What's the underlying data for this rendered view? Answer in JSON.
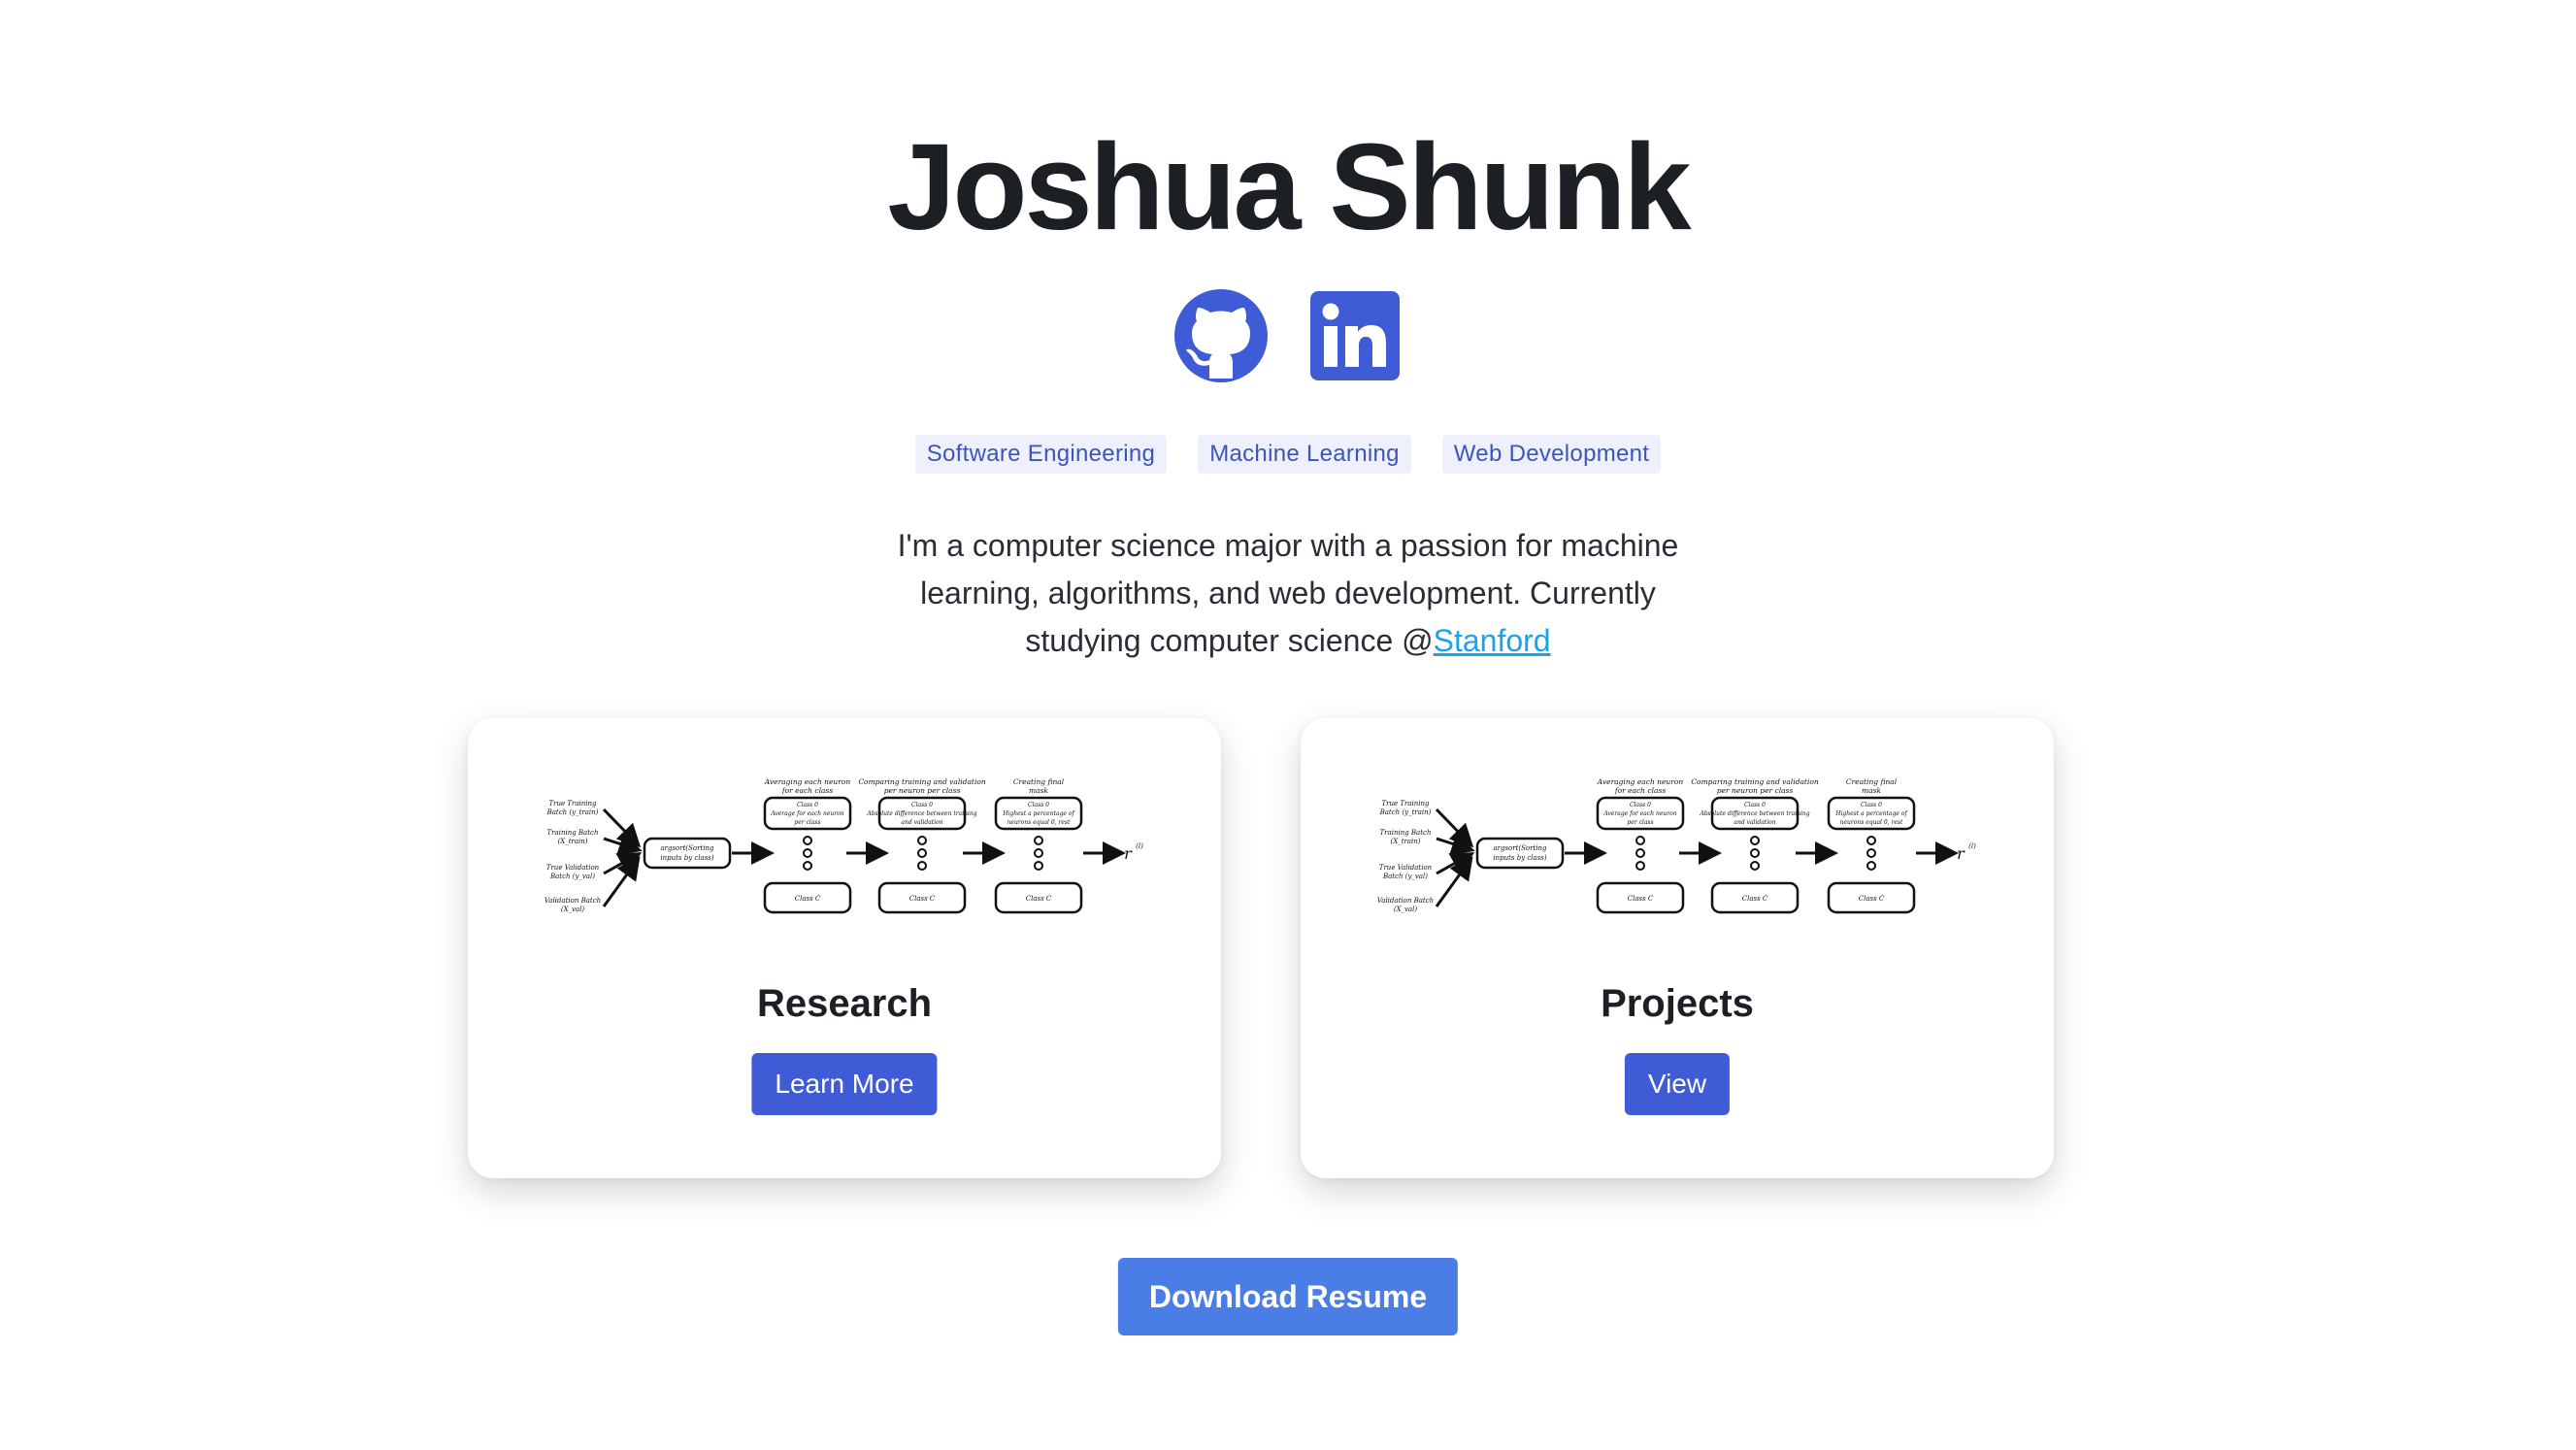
{
  "header": {
    "name": "Joshua Shunk"
  },
  "socials": [
    {
      "name": "github-icon"
    },
    {
      "name": "linkedin-icon"
    }
  ],
  "tags": [
    "Software Engineering",
    "Machine Learning",
    "Web Development"
  ],
  "bio": {
    "text": "I'm a computer science major with a passion for machine learning, algorithms, and web development. Currently studying computer science @",
    "link_text": "Stanford"
  },
  "cards": {
    "research": {
      "title": "Research",
      "button": "Learn More"
    },
    "projects": {
      "title": "Projects",
      "button": "View"
    }
  },
  "diagram": {
    "inputs": [
      "True Training Batch (y_train)",
      "Training Batch (X_train)",
      "True Validation Batch (y_val)",
      "Validation Batch (X_val)"
    ],
    "argsort": "argsort(Sorting inputs by class)",
    "stage_headers": [
      "Averaging each neuron for each class",
      "Comparing training and validation per neuron per class",
      "Creating final mask"
    ],
    "stage_top": [
      "Class 0 Average for each neuron per class",
      "Class 0 Absolute difference between training and validation",
      "Class 0 Highest a percentage of neurons equal 0, rest equal"
    ],
    "stage_bottom": "Class C",
    "output": "r",
    "output_sup": "(l)"
  },
  "download": {
    "label": "Download Resume"
  },
  "colors": {
    "accent": "#3f5bd6",
    "download": "#4a7de6",
    "tag_bg": "#eef1fb",
    "tag_text": "#3e55b8",
    "link": "#1aa3e8"
  }
}
